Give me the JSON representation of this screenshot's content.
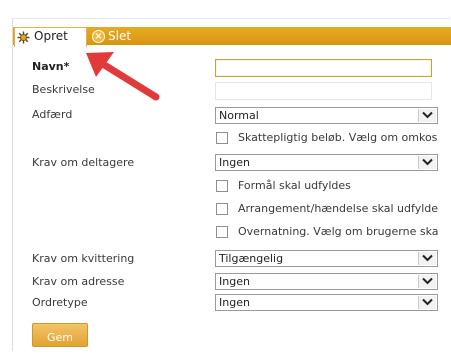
{
  "toolbar": {
    "create_label": "Opret",
    "delete_label": "Slet",
    "create_icon": "sun-burst-icon",
    "delete_icon": "close-circle-icon",
    "accent_color": "#e0a019"
  },
  "form": {
    "name": {
      "label": "Navn*",
      "value": ""
    },
    "description": {
      "label": "Beskrivelse",
      "value": ""
    },
    "behavior": {
      "label": "Adfærd",
      "value": "Normal"
    },
    "taxable": {
      "label": "Skattepligtig beløb. Vælg om omkos",
      "checked": false
    },
    "participants_req": {
      "label": "Krav om deltagere",
      "value": "Ingen"
    },
    "purpose": {
      "label": "Formål skal udfyldes",
      "checked": false
    },
    "event": {
      "label": "Arrangement/hændelse skal udfylde",
      "checked": false
    },
    "overnight": {
      "label": "Overnatning. Vælg om brugerne ska",
      "checked": false
    },
    "receipt_req": {
      "label": "Krav om kvittering",
      "value": "Tilgængelig"
    },
    "address_req": {
      "label": "Krav om adresse",
      "value": "Ingen"
    },
    "order_type": {
      "label": "Ordretype",
      "value": "Ingen"
    },
    "save_label": "Gem"
  }
}
